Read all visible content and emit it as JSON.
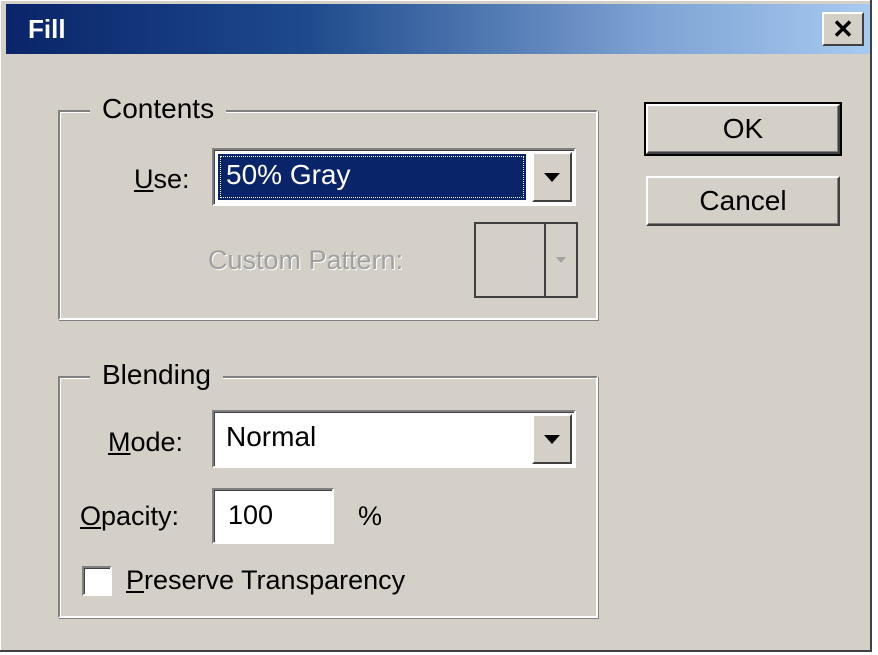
{
  "window": {
    "title": "Fill",
    "close_glyph": "✕"
  },
  "contents": {
    "group_label": "Contents",
    "use_label": "Use:",
    "use_value": "50% Gray",
    "custom_pattern_label": "Custom Pattern:"
  },
  "blending": {
    "group_label": "Blending",
    "mode_label": "Mode:",
    "mode_value": "Normal",
    "opacity_label": "Opacity:",
    "opacity_value": "100",
    "opacity_unit": "%",
    "preserve_transparency_label": "Preserve Transparency",
    "preserve_transparency_checked": false
  },
  "buttons": {
    "ok": "OK",
    "cancel": "Cancel"
  },
  "colors": {
    "face": "#d4d0c8",
    "title_start": "#0a246a",
    "title_end": "#a6caf0",
    "selection": "#0a246a"
  },
  "icons": {
    "close": "close-icon",
    "dropdown": "chevron-down-icon"
  }
}
